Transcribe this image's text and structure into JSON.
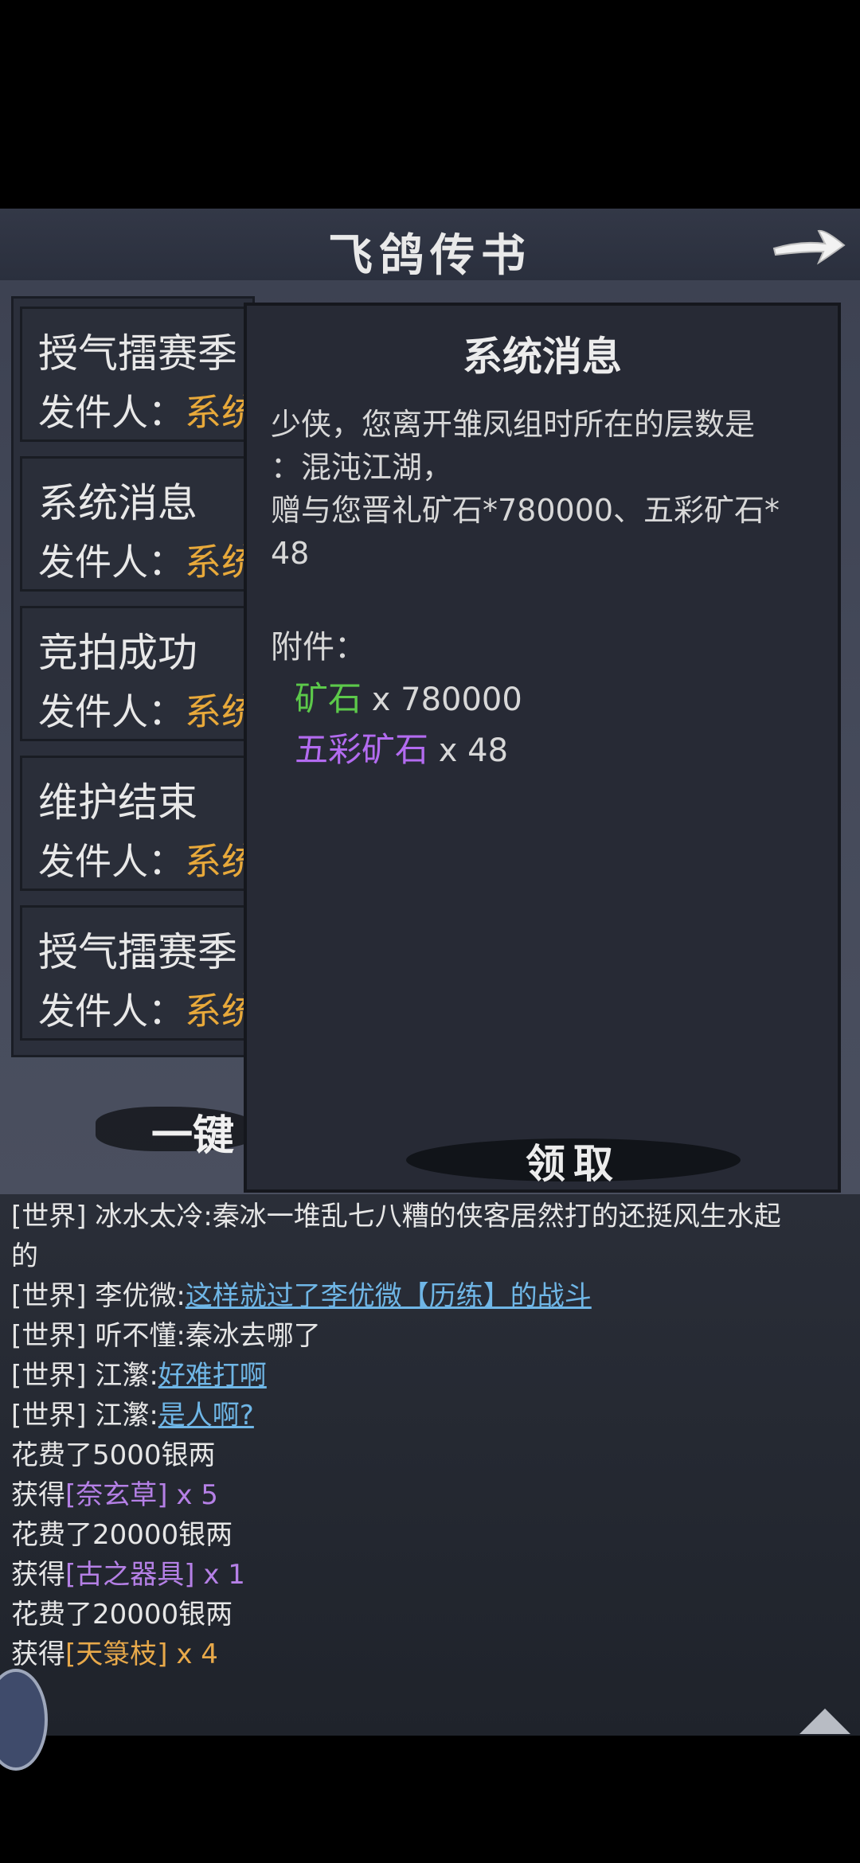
{
  "header": {
    "title": "飞鸽传书"
  },
  "mail_list": [
    {
      "subject": "授气擂赛季",
      "sender_label": "发件人：",
      "sender": "系统"
    },
    {
      "subject": "系统消息",
      "sender_label": "发件人：",
      "sender": "系统"
    },
    {
      "subject": "竞拍成功",
      "sender_label": "发件人：",
      "sender": "系统"
    },
    {
      "subject": "维护结束",
      "sender_label": "发件人：",
      "sender": "系统"
    },
    {
      "subject": "授气擂赛季",
      "sender_label": "发件人：",
      "sender": "系统"
    }
  ],
  "one_key_label": "一键",
  "detail": {
    "title": "系统消息",
    "line1": "少侠，您离开雏凤组时所在的层数是",
    "line2": "：混沌江湖，",
    "line3": "赠与您晋礼矿石*780000、五彩矿石*",
    "line4": "48",
    "attachments_label": "附件：",
    "attachments": [
      {
        "name": "矿石",
        "qty": "x 780000",
        "color": "#5cc94a"
      },
      {
        "name": "五彩矿石",
        "qty": "x 48",
        "color": "#b36bf0"
      }
    ],
    "receive_label": "领取"
  },
  "chat": [
    {
      "channel": "[世界]",
      "name": "冰水太冷",
      "sep": ":",
      "text": "秦冰一堆乱七八糟的侠客居然打的还挺风生水起"
    },
    {
      "cont": "的"
    },
    {
      "channel": "[世界]",
      "name": "李优微",
      "sep": ":",
      "link": "这样就过了李优微【历练】的战斗"
    },
    {
      "channel": "[世界]",
      "name": "听不懂",
      "sep": ":",
      "text": "秦冰去哪了"
    },
    {
      "channel": "[世界]",
      "name": "江瀿",
      "sep": ":",
      "link": "好难打啊"
    },
    {
      "channel": "[世界]",
      "name": "江瀿",
      "sep": ":",
      "link": "是人啊? "
    },
    {
      "plain": "花费了5000银两"
    },
    {
      "prefix": "获得",
      "item": "[奈玄草]",
      "qty": " x 5",
      "color": "pur"
    },
    {
      "plain": "花费了20000银两"
    },
    {
      "prefix": "获得",
      "item": "[古之器具]",
      "qty": " x 1",
      "color": "pur"
    },
    {
      "plain": "花费了20000银两"
    },
    {
      "prefix": "获得",
      "item": "[天箓枝]",
      "qty": " x 4",
      "color": "org"
    }
  ],
  "colors": {
    "sender": "#e8a93a",
    "link": "#6fb6e6",
    "purple_item": "#b580e6",
    "orange_item": "#e8a94a"
  },
  "icons": {
    "back": "arrow-right-icon",
    "scroll_up": "triangle-up-icon"
  }
}
